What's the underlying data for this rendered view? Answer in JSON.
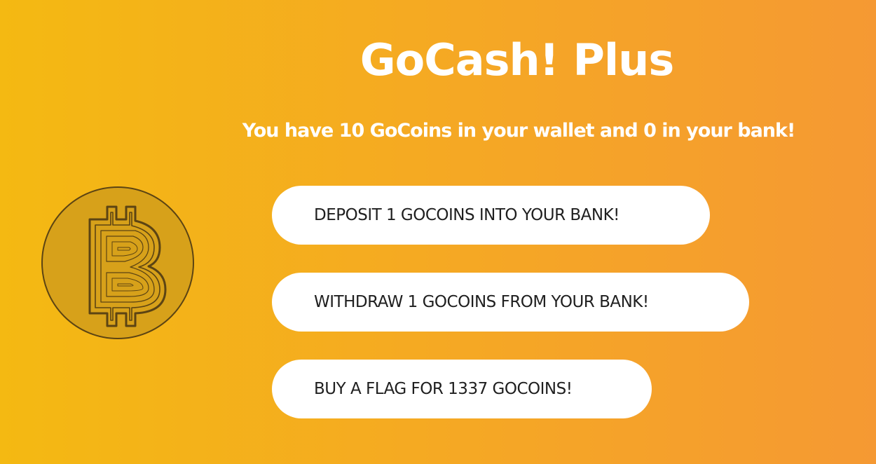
{
  "app": {
    "title": "GoCash! Plus",
    "status": "You have 10 GoCoins in your wallet and 0 in your bank!"
  },
  "actions": {
    "deposit_label": "DEPOSIT 1 GOCOINS INTO YOUR BANK!",
    "withdraw_label": "WITHDRAW 1 GOCOINS FROM YOUR BANK!",
    "buy_flag_label": "BUY A FLAG FOR 1337 GOCOINS!"
  },
  "icons": {
    "coin": "bitcoin-coin-icon"
  },
  "colors": {
    "background_start": "#F4B912",
    "background_end": "#F59933",
    "text": "#FFFFFF",
    "button_bg": "#FFFFFF",
    "button_text": "#1F1F1F",
    "coin_fill": "#D7A11A",
    "coin_line": "#5C4413"
  }
}
